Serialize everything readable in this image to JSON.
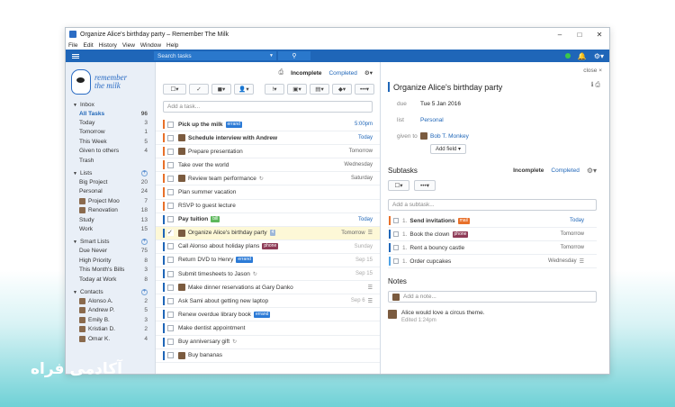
{
  "window": {
    "title": "Organize Alice's birthday party – Remember The Milk"
  },
  "menu": [
    "File",
    "Edit",
    "History",
    "View",
    "Window",
    "Help"
  ],
  "topbar": {
    "search_placeholder": "Search tasks"
  },
  "logo": {
    "line1": "remember",
    "line2": "the milk"
  },
  "sidebar": {
    "inbox": {
      "label": "Inbox",
      "items": [
        {
          "label": "All Tasks",
          "count": "96",
          "active": true
        },
        {
          "label": "Today",
          "count": "3"
        },
        {
          "label": "Tomorrow",
          "count": "1"
        },
        {
          "label": "This Week",
          "count": "5"
        },
        {
          "label": "Given to others",
          "count": "4"
        },
        {
          "label": "Trash",
          "count": ""
        }
      ]
    },
    "lists": {
      "label": "Lists",
      "items": [
        {
          "label": "Big Project",
          "count": "20"
        },
        {
          "label": "Personal",
          "count": "24"
        },
        {
          "label": "Project Moo",
          "count": "7",
          "avatar": true
        },
        {
          "label": "Renovation",
          "count": "18",
          "avatar": true
        },
        {
          "label": "Study",
          "count": "13"
        },
        {
          "label": "Work",
          "count": "15"
        }
      ]
    },
    "smart": {
      "label": "Smart Lists",
      "items": [
        {
          "label": "Due Never",
          "count": "75"
        },
        {
          "label": "High Priority",
          "count": "8"
        },
        {
          "label": "This Month's Bills",
          "count": "3"
        },
        {
          "label": "Today at Work",
          "count": "8"
        }
      ]
    },
    "contacts": {
      "label": "Contacts",
      "items": [
        {
          "label": "Alonso A.",
          "count": "2"
        },
        {
          "label": "Andrew P.",
          "count": "5"
        },
        {
          "label": "Emily B.",
          "count": "3"
        },
        {
          "label": "Kristian D.",
          "count": "2"
        },
        {
          "label": "Omar K.",
          "count": "4"
        }
      ]
    }
  },
  "tasks_panel": {
    "tab_incomplete": "Incomplete",
    "tab_completed": "Completed",
    "add_placeholder": "Add a task..."
  },
  "tasks": [
    {
      "name": "Pick up the milk",
      "tag": "errand",
      "tag_color": "#2b7ad6",
      "due": "5:00pm",
      "due_style": "blue",
      "bold": true,
      "pri": "#e8702a"
    },
    {
      "name": "Schedule interview with Andrew",
      "due": "Today",
      "due_style": "blue",
      "bold": true,
      "avatar": true,
      "pri": "#e8702a"
    },
    {
      "name": "Prepare presentation",
      "due": "Tomorrow",
      "avatar": true,
      "pri": "#e8702a"
    },
    {
      "name": "Take over the world",
      "due": "Wednesday",
      "pri": "#e8702a"
    },
    {
      "name": "Review team performance",
      "due": "Saturday",
      "avatar": true,
      "repeat": true,
      "pri": "#e8702a"
    },
    {
      "name": "Plan summer vacation",
      "due": "",
      "pri": "#e8702a"
    },
    {
      "name": "RSVP to guest lecture",
      "due": "",
      "pri": "#e8702a"
    },
    {
      "name": "Pay tuition",
      "tag": "bill",
      "tag_color": "#5db85c",
      "due": "Today",
      "due_style": "blue",
      "bold": true,
      "pri": "#1f66b8"
    },
    {
      "name": "Organize Alice's birthday party",
      "tag": "4",
      "tag_color": "#9db7d8",
      "due": "Tomorrow",
      "avatar": true,
      "notes": true,
      "selected": true,
      "pri": "#1f66b8"
    },
    {
      "name": "Call Alonso about holiday plans",
      "tag": "phone",
      "tag_color": "#8e3b57",
      "due": "Sunday",
      "due_style": "gray",
      "pri": "#1f66b8"
    },
    {
      "name": "Return DVD to Henry",
      "tag": "errand",
      "tag_color": "#2b7ad6",
      "due": "Sep 15",
      "due_style": "gray",
      "pri": "#1f66b8"
    },
    {
      "name": "Submit timesheets to Jason",
      "due": "Sep 15",
      "due_style": "gray",
      "repeat": true,
      "pri": "#1f66b8"
    },
    {
      "name": "Make dinner reservations at Gary Danko",
      "due": "",
      "avatar": true,
      "notes": true,
      "pri": "#1f66b8"
    },
    {
      "name": "Ask Sami about getting new laptop",
      "due": "Sep 6",
      "due_style": "gray",
      "notes": true,
      "pri": "#1f66b8"
    },
    {
      "name": "Renew overdue library book",
      "tag": "errand",
      "tag_color": "#2b7ad6",
      "due": "",
      "pri": "#1f66b8"
    },
    {
      "name": "Make dentist appointment",
      "due": "",
      "pri": "#1f66b8"
    },
    {
      "name": "Buy anniversary gift",
      "due": "",
      "repeat": true,
      "pri": "#1f66b8"
    },
    {
      "name": "Buy bananas",
      "due": "",
      "avatar": true,
      "pri": "#1f66b8"
    }
  ],
  "detail": {
    "close": "close ×",
    "title": "Organize Alice's birthday party",
    "due_label": "due",
    "due_value": "Tue 5 Jan 2016",
    "list_label": "list",
    "list_value": "Personal",
    "given_label": "given to",
    "given_value": "Bob T. Monkey",
    "add_field": "Add field",
    "subtasks_title": "Subtasks",
    "tab_incomplete": "Incomplete",
    "tab_completed": "Completed",
    "add_subtask": "Add a subtask...",
    "subtasks": [
      {
        "num": "1.",
        "name": "Send invitations",
        "tag": "mail",
        "tag_color": "#e8702a",
        "due": "Today",
        "blue": true,
        "bold": true,
        "pri": "#e8702a"
      },
      {
        "num": "1.",
        "name": "Book the clown",
        "tag": "phone",
        "tag_color": "#8e3b57",
        "due": "Tomorrow",
        "pri": "#1f66b8"
      },
      {
        "num": "1.",
        "name": "Rent a bouncy castle",
        "due": "Tomorrow",
        "pri": "#1f66b8"
      },
      {
        "num": "1.",
        "name": "Order cupcakes",
        "due": "Wednesday",
        "notes": true,
        "pri": "#4fa3e6"
      }
    ],
    "notes_title": "Notes",
    "add_note": "Add a note...",
    "note_text": "Alice would love a circus theme.",
    "note_meta": "Edited 1:24pm"
  },
  "brand_text": "آکادمی فراه"
}
